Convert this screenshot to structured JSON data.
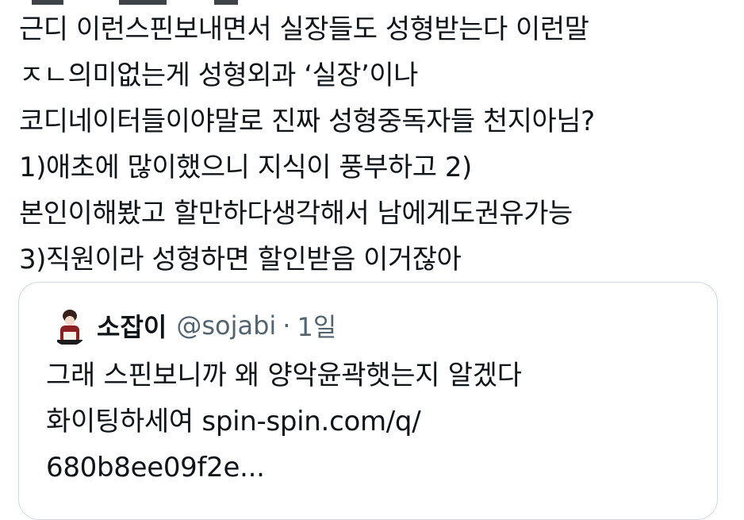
{
  "tweet": {
    "lines": [
      "근디 이런스핀보내면서 실장들도 성형받는다 이런말",
      "ㅈㄴ의미없는게 성형외과 ‘실장’이나",
      "코디네이터들이야말로 진짜 성형중독자들 천지아님?",
      "1)애초에 많이했으니 지식이 풍부하고 2)",
      "본인이해봤고 할만하다생각해서 남에게도권유가능",
      "3)직원이라 성형하면 할인받음 이거잖아"
    ]
  },
  "quote": {
    "avatar_icon": "user-avatar-photo",
    "display_name": "소잡이",
    "handle": "@sojabi",
    "separator": "·",
    "time": "1일",
    "line1": "그래  스핀보니까 왜 양악윤곽햇는지 알겠다",
    "line2_text": "화이팅하세여",
    "link_part1": "spin-spin.com/q/",
    "link_part2": "680b8ee09f2e..."
  },
  "colors": {
    "text": "#0f1419",
    "secondary": "#536471",
    "border": "#cfd9de"
  }
}
